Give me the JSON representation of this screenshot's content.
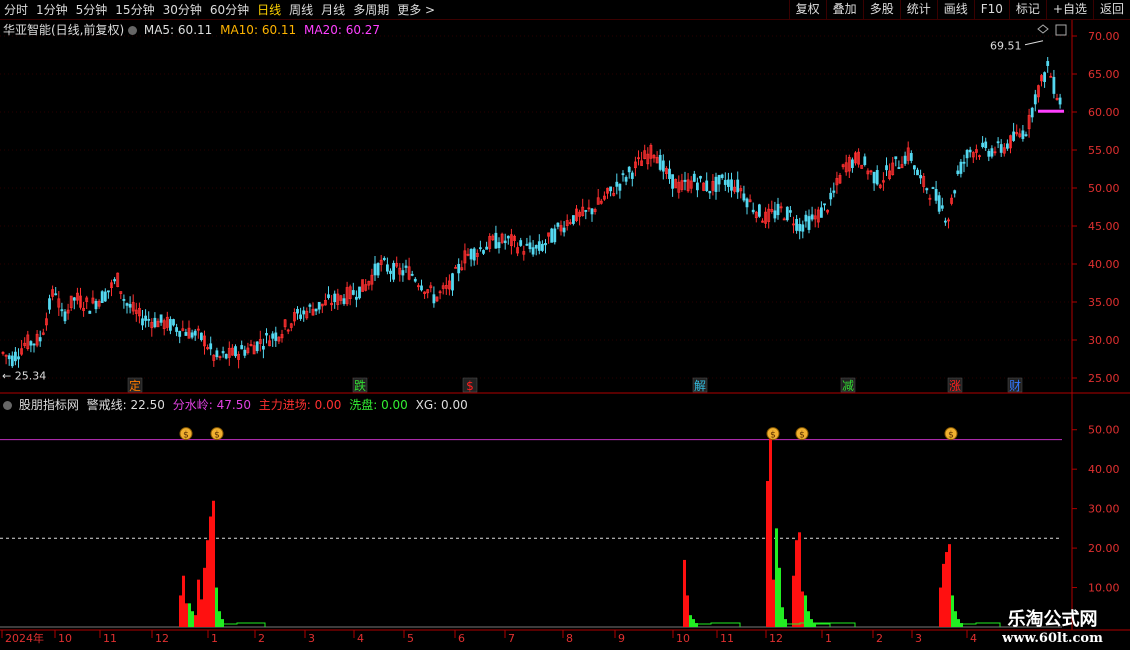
{
  "toolbar": {
    "periods": [
      {
        "label": "分时",
        "active": false
      },
      {
        "label": "1分钟",
        "active": false
      },
      {
        "label": "5分钟",
        "active": false
      },
      {
        "label": "15分钟",
        "active": false
      },
      {
        "label": "30分钟",
        "active": false
      },
      {
        "label": "60分钟",
        "active": false
      },
      {
        "label": "日线",
        "active": true
      },
      {
        "label": "周线",
        "active": false
      },
      {
        "label": "月线",
        "active": false
      },
      {
        "label": "多周期",
        "active": false
      },
      {
        "label": "更多 >",
        "active": false
      }
    ],
    "actions": [
      "复权",
      "叠加",
      "多股",
      "统计",
      "画线",
      "F10",
      "标记",
      "+自选",
      "返回"
    ]
  },
  "main": {
    "stock_title": "华亚智能(日线,前复权)",
    "ma5_label": "MA5:",
    "ma5_value": "60.11",
    "ma10_label": "MA10:",
    "ma10_value": "60.11",
    "ma20_label": "MA20:",
    "ma20_value": "60.27",
    "high_label": "69.51",
    "low_label": "25.34",
    "events": [
      {
        "text": "定",
        "color": "#ff7a00"
      },
      {
        "text": "跌",
        "color": "#33dd33"
      },
      {
        "text": "$",
        "color": "#ff2020"
      },
      {
        "text": "解",
        "color": "#33bbdd"
      },
      {
        "text": "减",
        "color": "#33dd33"
      },
      {
        "text": "涨",
        "color": "#ff2020"
      },
      {
        "text": "财",
        "color": "#3377ff"
      }
    ]
  },
  "indicator": {
    "name": "股朋指标网",
    "warn_label": "警戒线:",
    "warn_value": "22.50",
    "divide_label": "分水岭:",
    "divide_value": "47.50",
    "main_label": "主力进场:",
    "main_value": "0.00",
    "wash_label": "洗盘:",
    "wash_value": "0.00",
    "xg_label": "XG:",
    "xg_value": "0.00"
  },
  "axes": {
    "price_ticks": [
      "70.00",
      "65.00",
      "60.00",
      "55.00",
      "50.00",
      "45.00",
      "40.00",
      "35.00",
      "30.00",
      "25.00"
    ],
    "ind_ticks": [
      "50.00",
      "40.00",
      "30.00",
      "20.00",
      "10.00"
    ],
    "date_labels": [
      "2024年",
      "10",
      "11",
      "12",
      "1",
      "2",
      "3",
      "4",
      "5",
      "6",
      "7",
      "8",
      "9",
      "10",
      "11",
      "12",
      "1",
      "2",
      "3",
      "4"
    ]
  },
  "chart_data": {
    "type": "candlestick",
    "price_axis": {
      "min": 25,
      "max": 70,
      "ticks": [
        70,
        65,
        60,
        55,
        50,
        45,
        40,
        35,
        30,
        25
      ]
    },
    "price_path": [
      [
        0,
        28.5
      ],
      [
        12,
        27.5
      ],
      [
        25,
        29.5
      ],
      [
        40,
        30
      ],
      [
        55,
        37
      ],
      [
        62,
        33
      ],
      [
        75,
        35.5
      ],
      [
        90,
        34.5
      ],
      [
        105,
        36
      ],
      [
        118,
        38
      ],
      [
        125,
        35
      ],
      [
        140,
        33
      ],
      [
        155,
        32.5
      ],
      [
        170,
        32
      ],
      [
        190,
        31
      ],
      [
        205,
        30
      ],
      [
        215,
        27.5
      ],
      [
        230,
        28
      ],
      [
        250,
        29
      ],
      [
        265,
        30
      ],
      [
        280,
        31
      ],
      [
        295,
        33
      ],
      [
        310,
        34
      ],
      [
        330,
        35
      ],
      [
        350,
        36
      ],
      [
        365,
        37
      ],
      [
        380,
        40
      ],
      [
        395,
        39
      ],
      [
        410,
        39
      ],
      [
        425,
        37
      ],
      [
        435,
        35.5
      ],
      [
        450,
        37
      ],
      [
        465,
        41
      ],
      [
        480,
        42
      ],
      [
        495,
        43
      ],
      [
        510,
        43
      ],
      [
        525,
        42
      ],
      [
        540,
        42
      ],
      [
        555,
        44
      ],
      [
        570,
        46
      ],
      [
        585,
        46.5
      ],
      [
        600,
        48
      ],
      [
        615,
        50
      ],
      [
        630,
        52
      ],
      [
        645,
        54
      ],
      [
        655,
        55
      ],
      [
        665,
        52
      ],
      [
        680,
        50
      ],
      [
        695,
        51
      ],
      [
        710,
        50
      ],
      [
        725,
        51
      ],
      [
        740,
        50
      ],
      [
        750,
        48
      ],
      [
        765,
        46
      ],
      [
        780,
        47
      ],
      [
        790,
        46.5
      ],
      [
        800,
        45
      ],
      [
        815,
        46
      ],
      [
        830,
        48
      ],
      [
        845,
        53
      ],
      [
        860,
        54
      ],
      [
        870,
        52
      ],
      [
        880,
        51
      ],
      [
        895,
        53
      ],
      [
        910,
        54.5
      ],
      [
        920,
        51
      ],
      [
        935,
        49
      ],
      [
        948,
        46
      ],
      [
        958,
        52
      ],
      [
        970,
        55
      ],
      [
        985,
        55
      ],
      [
        1000,
        55
      ],
      [
        1015,
        56.5
      ],
      [
        1028,
        58
      ],
      [
        1035,
        62
      ],
      [
        1042,
        64
      ],
      [
        1048,
        66
      ],
      [
        1055,
        63
      ],
      [
        1062,
        61
      ]
    ],
    "high": 69.51,
    "low": 25.34,
    "indicator": {
      "ylim": [
        0,
        55
      ],
      "warning_line": 22.5,
      "divide_line": 47.5,
      "red_bars": [
        [
          180,
          8
        ],
        [
          183,
          13
        ],
        [
          186,
          6
        ],
        [
          195,
          3
        ],
        [
          198,
          12
        ],
        [
          201,
          7
        ],
        [
          204,
          15
        ],
        [
          207,
          22
        ],
        [
          210,
          28
        ],
        [
          213,
          32
        ],
        [
          684,
          17
        ],
        [
          687,
          8
        ],
        [
          767,
          37
        ],
        [
          770,
          49
        ],
        [
          773,
          12
        ],
        [
          793,
          13
        ],
        [
          796,
          22
        ],
        [
          799,
          24
        ],
        [
          802,
          9
        ],
        [
          940,
          10
        ],
        [
          943,
          16
        ],
        [
          946,
          19
        ],
        [
          949,
          21
        ]
      ],
      "green_bars": [
        [
          189,
          6
        ],
        [
          192,
          4
        ],
        [
          216,
          10
        ],
        [
          219,
          4
        ],
        [
          222,
          2
        ],
        [
          690,
          3
        ],
        [
          693,
          2
        ],
        [
          696,
          1
        ],
        [
          776,
          25
        ],
        [
          779,
          15
        ],
        [
          782,
          5
        ],
        [
          785,
          2
        ],
        [
          805,
          8
        ],
        [
          808,
          4
        ],
        [
          811,
          2
        ],
        [
          814,
          1
        ],
        [
          952,
          8
        ],
        [
          955,
          4
        ],
        [
          958,
          2
        ],
        [
          961,
          1
        ]
      ],
      "signal_marks": [
        186,
        217,
        773,
        802,
        951
      ]
    }
  },
  "watermark": {
    "line1": "乐淘公式网",
    "line2": "www.60lt.com"
  }
}
